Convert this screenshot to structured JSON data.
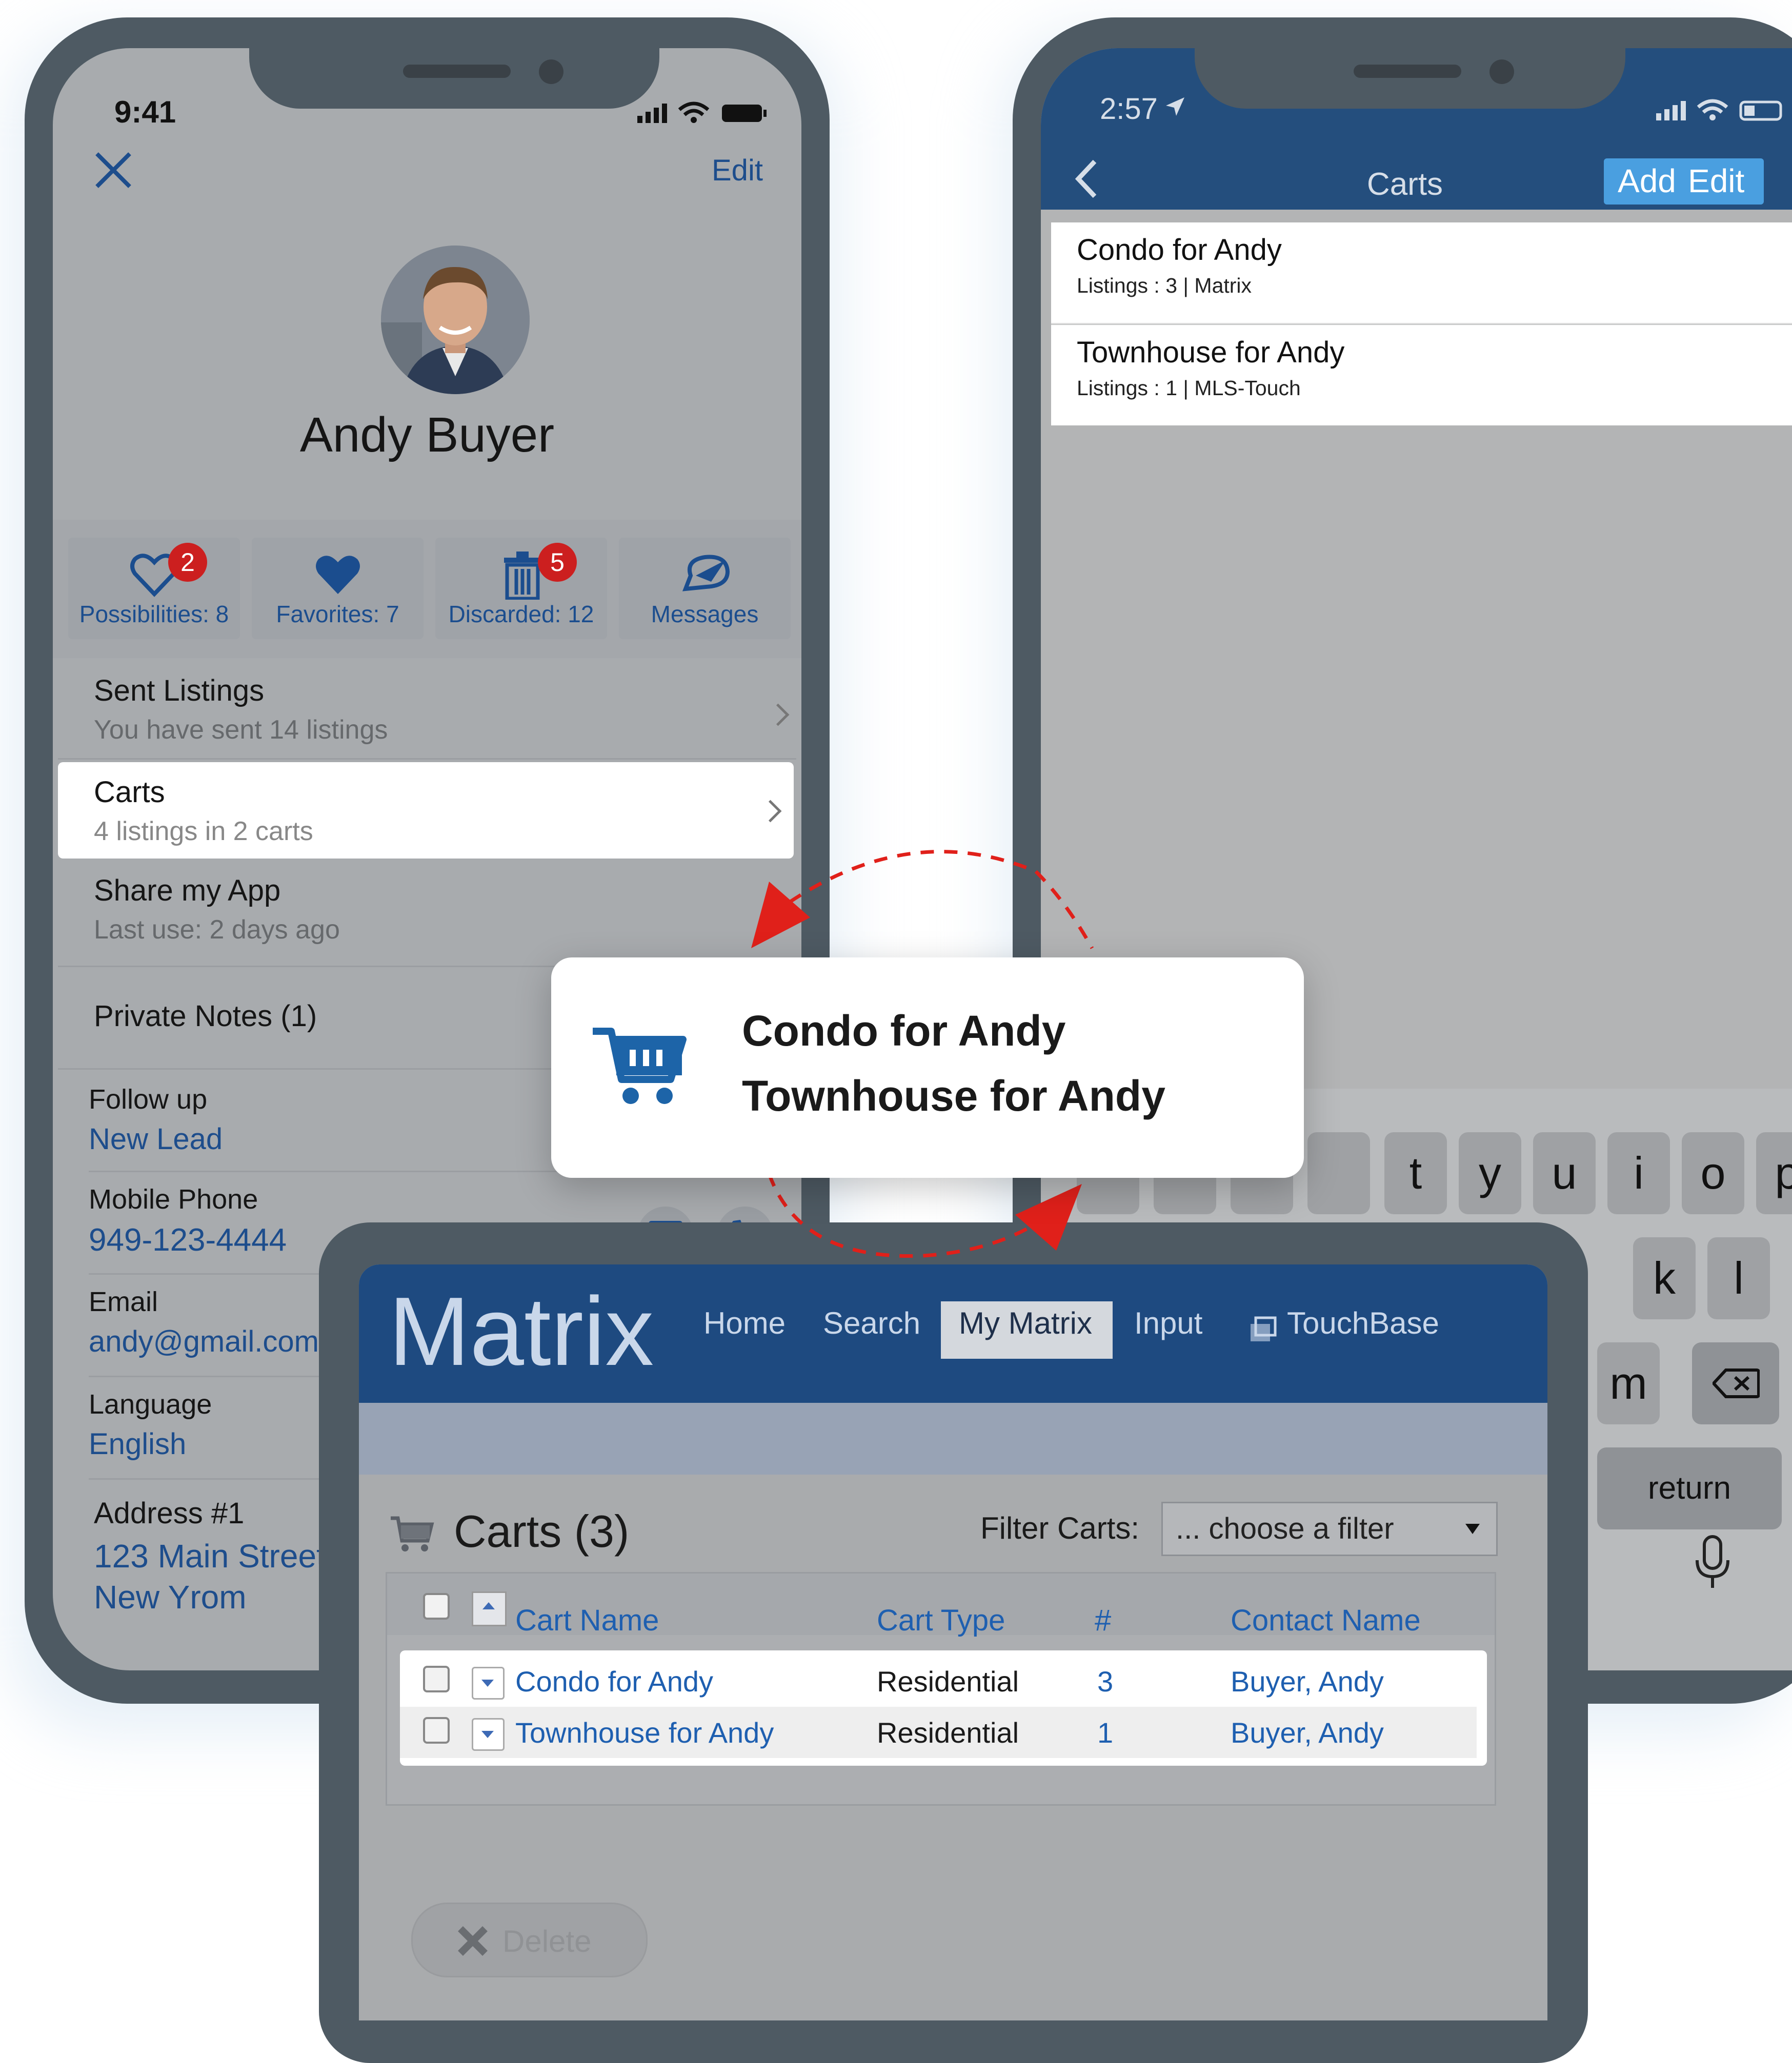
{
  "left_phone": {
    "status_time": "9:41",
    "close_icon": "close-icon",
    "edit_label": "Edit",
    "contact_name": "Andy Buyer",
    "stats": [
      {
        "label": "Possibilities: 8",
        "badge": "2",
        "icon": "heart-outline-icon"
      },
      {
        "label": "Favorites: 7",
        "badge": "",
        "icon": "heart-filled-icon"
      },
      {
        "label": "Discarded: 12",
        "badge": "5",
        "icon": "trash-icon"
      },
      {
        "label": "Messages",
        "badge": "",
        "icon": "messages-icon"
      }
    ],
    "sent_listings": {
      "title": "Sent Listings",
      "subtitle": "You have sent 14 listings"
    },
    "carts": {
      "title": "Carts",
      "subtitle": "4 listings in 2 carts"
    },
    "share_app": {
      "title": "Share my App",
      "subtitle": "Last use: 2 days ago"
    },
    "private_notes": "Private Notes (1)",
    "follow_up": {
      "label": "Follow up",
      "value": "New Lead"
    },
    "mobile_phone": {
      "label": "Mobile Phone",
      "value": "949-123-4444"
    },
    "email": {
      "label": "Email",
      "value": "andy@gmail.com"
    },
    "language": {
      "label": "Language",
      "value": "English"
    },
    "address": {
      "label": "Address #1",
      "line1": "123 Main Street",
      "line2": "New Yrom"
    }
  },
  "right_phone": {
    "status_time": "2:57",
    "title": "Carts",
    "add_label": "Add",
    "edit_label": "Edit",
    "carts": [
      {
        "name": "Condo for Andy",
        "subtitle": "Listings : 3 | Matrix"
      },
      {
        "name": "Townhouse for Andy",
        "subtitle": "Listings : 1 | MLS-Touch"
      }
    ],
    "keyboard": {
      "row1": [
        "t",
        "y",
        "u",
        "i",
        "o",
        "p"
      ],
      "row2": [
        "k",
        "l"
      ],
      "row3": [
        "m"
      ],
      "return_label": "return"
    }
  },
  "popup": {
    "icon": "cart-icon",
    "line1": "Condo for Andy",
    "line2": "Townhouse for Andy"
  },
  "matrix": {
    "logo": "Matrix",
    "nav": [
      "Home",
      "Search",
      "My Matrix",
      "Input",
      "TouchBase"
    ],
    "active_nav": "My Matrix",
    "heading": "Carts (3)",
    "filter_label": "Filter Carts:",
    "filter_value": "... choose a filter",
    "columns": [
      "Cart Name",
      "Cart Type",
      "#",
      "Contact Name"
    ],
    "rows": [
      {
        "name": "Condo for Andy",
        "type": "Residential",
        "count": "3",
        "contact": "Buyer, Andy"
      },
      {
        "name": "Townhouse for Andy",
        "type": "Residential",
        "count": "1",
        "contact": "Buyer, Andy"
      }
    ],
    "delete_label": "Delete"
  },
  "colors": {
    "navy": "#1e4a80",
    "accent_red": "#e0201a",
    "link_blue": "#1e5fb0",
    "badge_red": "#cc1f1f"
  }
}
